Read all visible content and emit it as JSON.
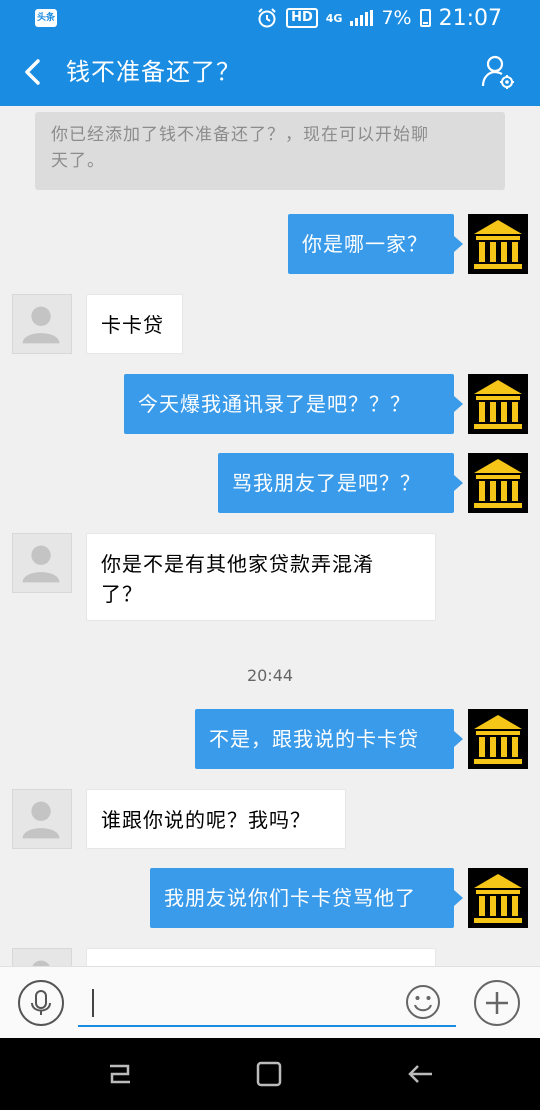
{
  "status_bar": {
    "app_badge": "头条",
    "hd": "HD",
    "network": "4G",
    "battery": "7%",
    "time": "21:07"
  },
  "header": {
    "title": "钱不准备还了？"
  },
  "system_note": {
    "line1": "你已经添加了钱不准备还了？，现在可以开始聊",
    "line2": "天了。"
  },
  "messages": [
    {
      "side": "out",
      "text": "你是哪一家？"
    },
    {
      "side": "in",
      "text": "卡卡贷"
    },
    {
      "side": "out",
      "text": "今天爆我通讯录了是吧？？？"
    },
    {
      "side": "out",
      "text": "骂我朋友了是吧？？"
    },
    {
      "side": "in",
      "text_line1": "你是不是有其他家贷款弄混淆",
      "text_line2": "了？"
    },
    {
      "side": "out",
      "text": "不是，跟我说的卡卡贷"
    },
    {
      "side": "in",
      "text": "谁跟你说的呢？我吗？"
    },
    {
      "side": "out",
      "text": "我朋友说你们卡卡贷骂他了"
    }
  ],
  "timestamp": "20:44",
  "input": {
    "value": ""
  },
  "icons": {
    "back": "back-arrow-icon",
    "profile": "profile-settings-icon",
    "mic": "microphone-icon",
    "emoji": "emoji-icon",
    "plus": "plus-icon",
    "bank": "bank-building-icon",
    "person": "person-silhouette-icon"
  },
  "colors": {
    "accent": "#1a8de2",
    "bubble_out": "#3a9bea",
    "bank_gold": "#f5c518"
  }
}
